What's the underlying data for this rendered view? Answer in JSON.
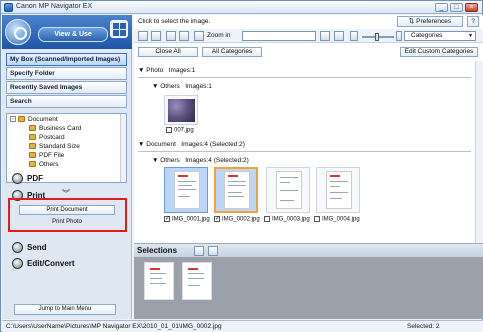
{
  "window": {
    "title": "Canon MP Navigator EX",
    "minimize": "_",
    "maximize": "□",
    "close": "×"
  },
  "sidebar": {
    "view_use_label": "View & Use",
    "nav": [
      {
        "label": "My Box (Scanned/Imported Images)",
        "selected": true
      },
      {
        "label": "Specify Folder",
        "selected": false
      },
      {
        "label": "Recently Saved Images",
        "selected": false
      },
      {
        "label": "Search",
        "selected": false
      }
    ],
    "tree": {
      "root": "Document",
      "children": [
        "Business Card",
        "Postcard",
        "Standard Size",
        "PDF File",
        "Others"
      ]
    },
    "collapse_icon": "double-chevron-down",
    "actions": {
      "pdf": "PDF",
      "print": "Print",
      "print_document": "Print Document",
      "print_photo": "Print Photo",
      "send": "Send",
      "edit_convert": "Edit/Convert"
    },
    "jump_button": "Jump to Main Menu"
  },
  "main": {
    "instruction": "Click to select the image.",
    "preferences": "Preferences",
    "help": "?",
    "zoom_label": "Zoom in",
    "search_value": "",
    "categories_select": "Categories",
    "close_all": "Close All",
    "all_categories": "All Categories",
    "edit_custom_categories": "Edit Custom Categories",
    "groups": {
      "photo_name": "Photo",
      "photo_count": "Images:1",
      "photo_others_name": "Others",
      "photo_others_count": "Images:1",
      "document_name": "Document",
      "document_count": "Images:4",
      "document_selected": "(Selected:2)",
      "doc_others_name": "Others",
      "doc_others_count": "Images:4",
      "doc_others_selected": "(Selected:2)"
    },
    "photo_images": [
      {
        "name": "007.jpg",
        "checked": false
      }
    ],
    "doc_images": [
      {
        "name": "IMG_0001.jpg",
        "checked": true
      },
      {
        "name": "IMG_0002.jpg",
        "checked": true
      },
      {
        "name": "IMG_0003.jpg",
        "checked": false
      },
      {
        "name": "IMG_0004.jpg",
        "checked": false
      }
    ],
    "selections_label": "Selections"
  },
  "status": {
    "path": "C:\\Users\\UserName\\Pictures\\MP Navigator EX\\2010_01_01\\IMG_0002.jpg",
    "selected": "Selected: 2"
  },
  "colors": {
    "highlight_box": "#e21b1b",
    "selected_thumb": "#bcd6fa",
    "accent": "#2c62b0"
  }
}
